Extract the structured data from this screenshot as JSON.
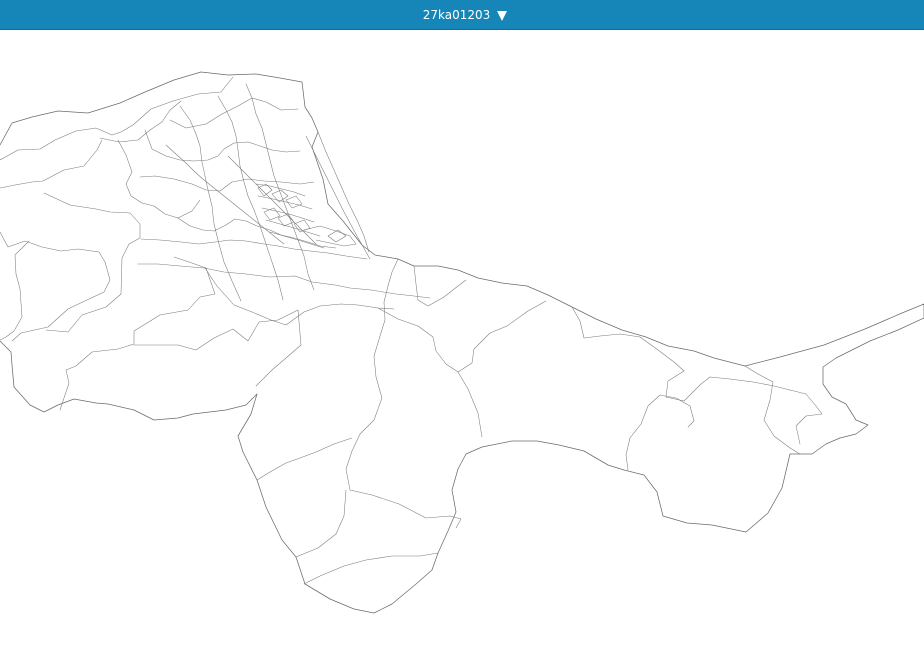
{
  "header": {
    "dataset_label": "27ka01203",
    "dropdown_icon": "triangle-down-icon",
    "background_color": "#1686b9",
    "text_color": "#ffffff"
  },
  "map": {
    "type": "boundary-map",
    "fill_color": "#ffffff",
    "stroke_color": "#6b6b6b"
  }
}
